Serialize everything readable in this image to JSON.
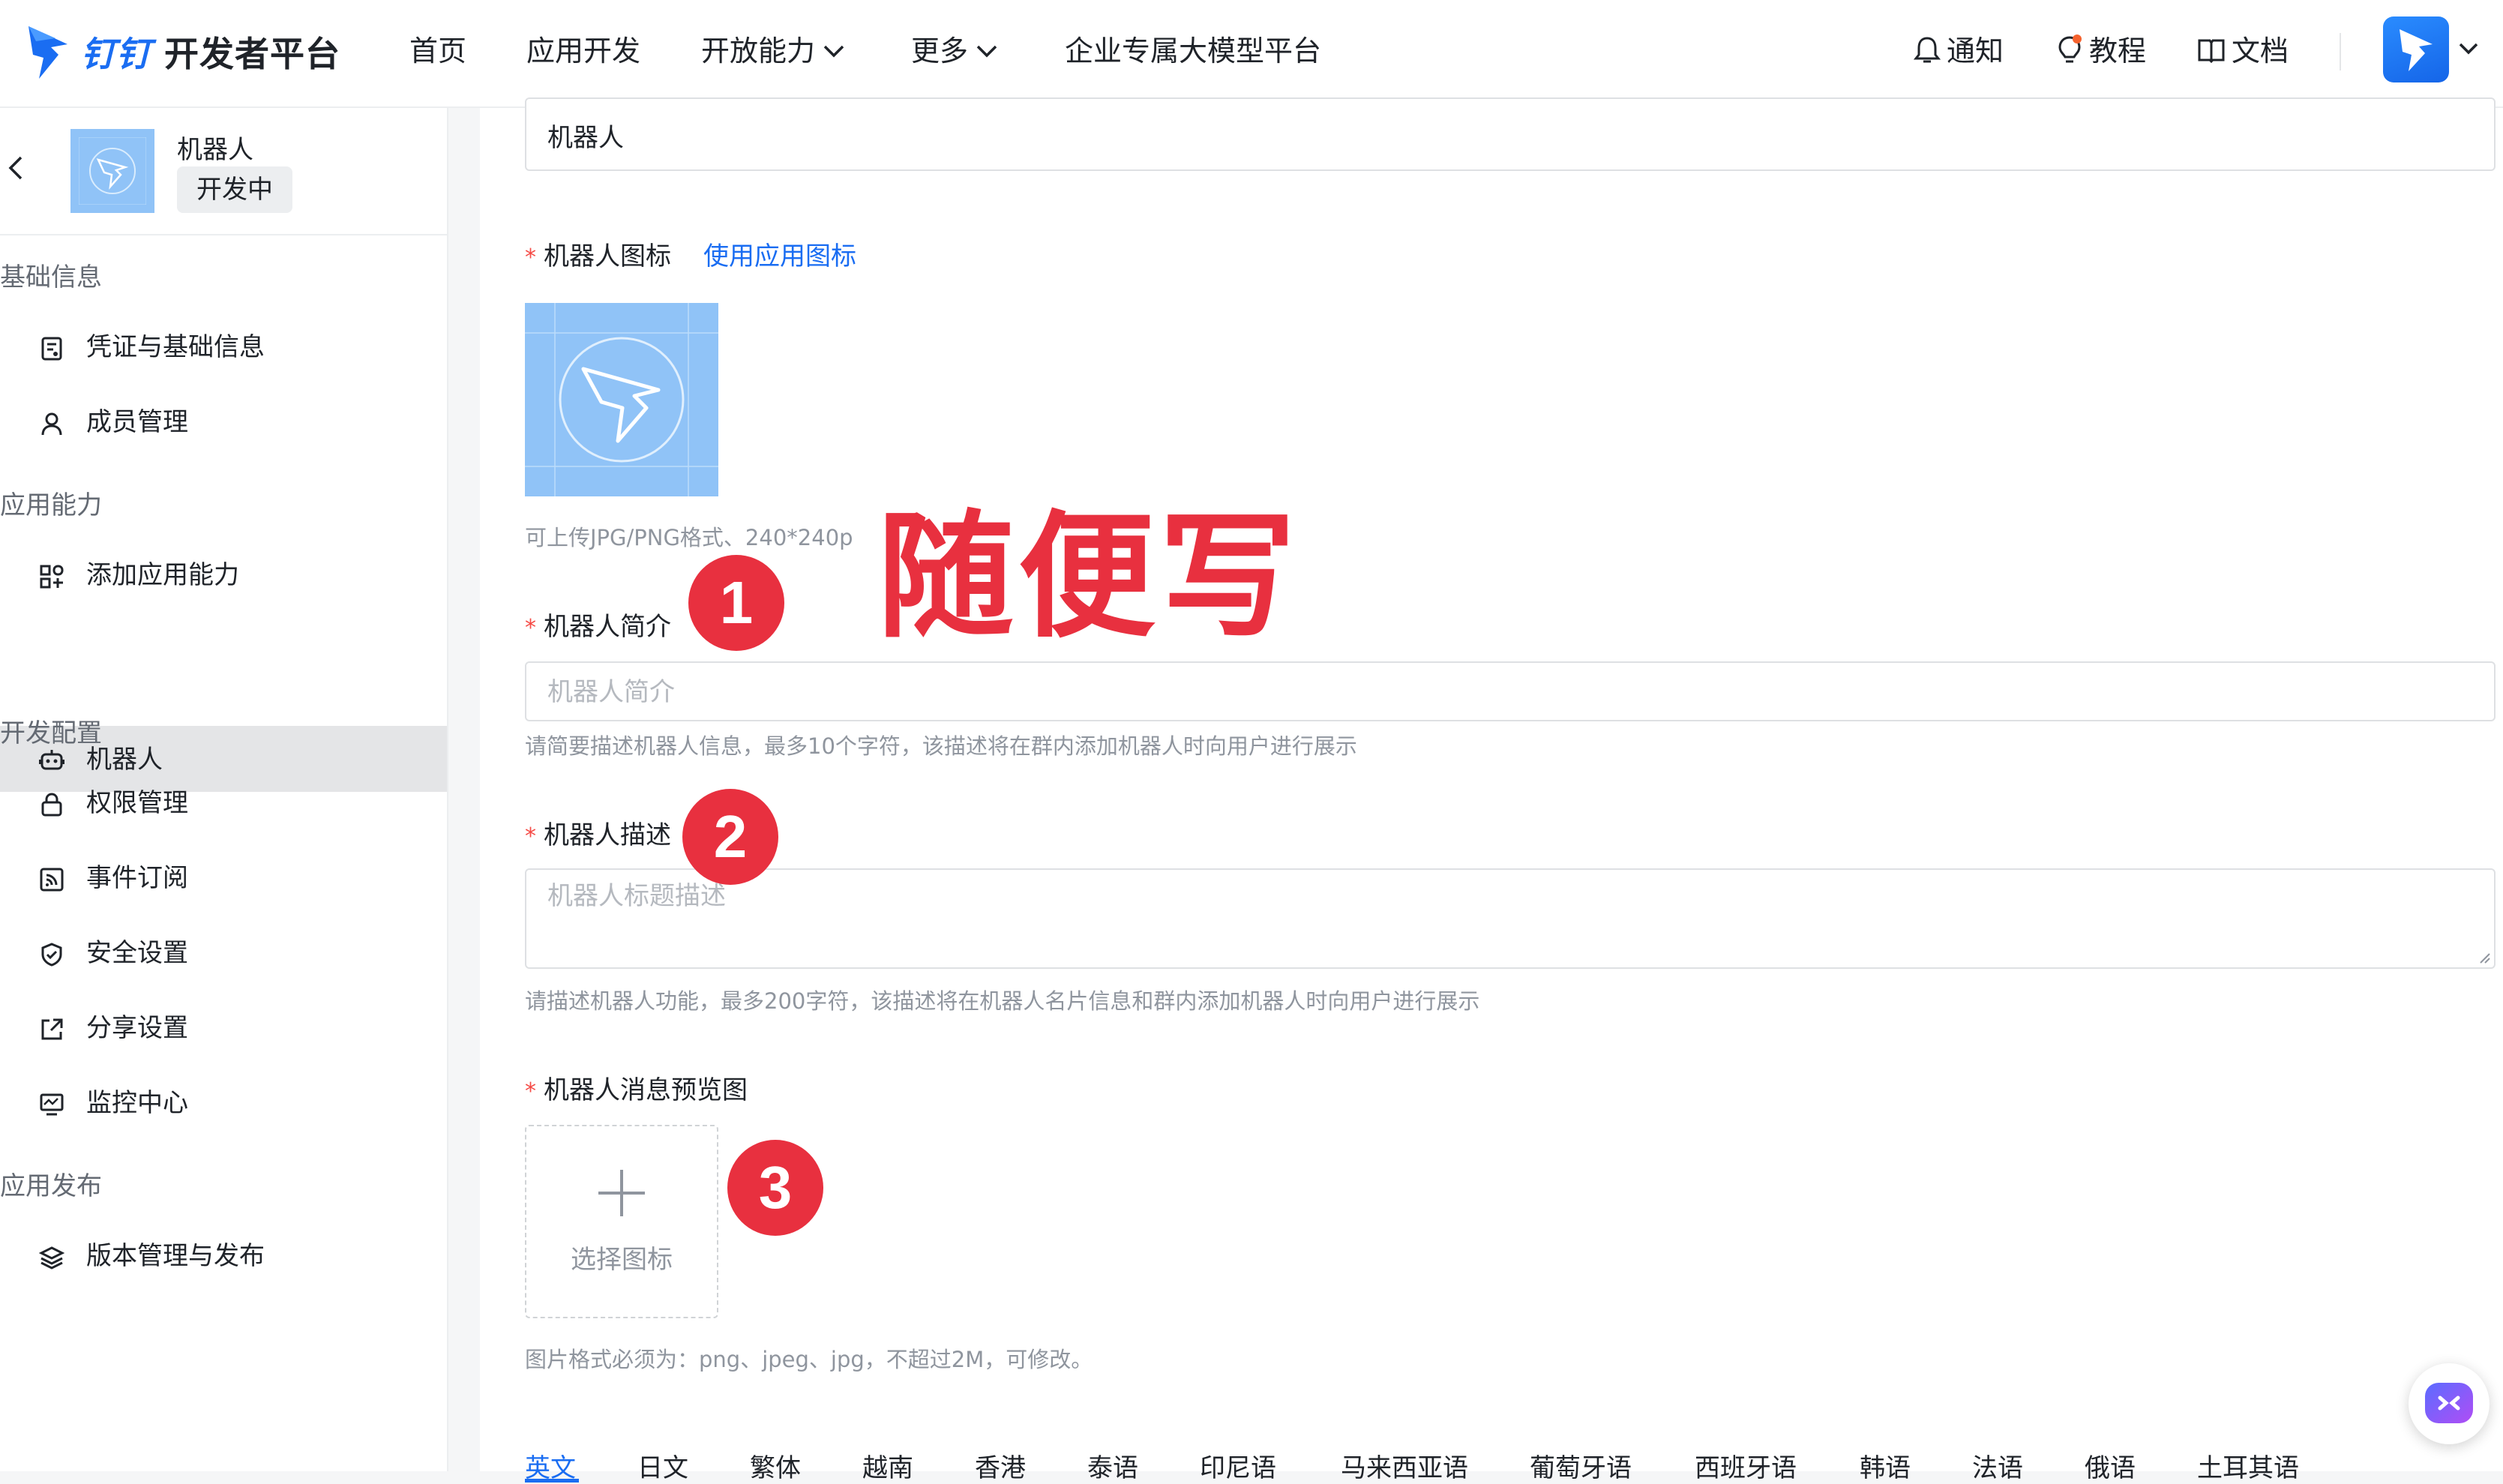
{
  "brand": {
    "ding": "钉钉",
    "name": "开发者平台"
  },
  "nav": [
    {
      "label": "首页"
    },
    {
      "label": "应用开发"
    },
    {
      "label": "开放能力"
    },
    {
      "label": "更多"
    },
    {
      "label": "企业专属大模型平台"
    }
  ],
  "header_right": {
    "notify": "通知",
    "tutorial": "教程",
    "docs": "文档"
  },
  "colors": {
    "accent": "#1a6df2",
    "annotation": "#e8303f",
    "icon_bg": "#90c3f7"
  },
  "sidebar": {
    "app_name": "机器人",
    "app_status": "开发中",
    "sections": {
      "basic": "基础信息",
      "ability": "应用能力",
      "dev": "开发配置",
      "publish": "应用发布"
    },
    "items": {
      "credentials": "凭证与基础信息",
      "members": "成员管理",
      "add_ability": "添加应用能力",
      "robot": "机器人",
      "permissions": "权限管理",
      "events": "事件订阅",
      "security": "安全设置",
      "share": "分享设置",
      "monitor": "监控中心",
      "version": "版本管理与发布"
    },
    "icons": {
      "credentials": "credential-icon",
      "members": "user-icon",
      "add_ability": "apps-add-icon",
      "robot": "robot-icon",
      "permissions": "lock-icon",
      "events": "rss-icon",
      "security": "shield-icon",
      "share": "share-icon",
      "monitor": "monitor-icon",
      "version": "layers-icon"
    }
  },
  "form": {
    "name_value": "机器人",
    "icon_label": "机器人图标",
    "icon_link": "使用应用图标",
    "icon_hint": "可上传JPG/PNG格式、240*240p",
    "intro_label": "机器人简介",
    "intro_placeholder": "机器人简介",
    "intro_hint": "请简要描述机器人信息，最多10个字符，该描述将在群内添加机器人时向用户进行展示",
    "desc_label": "机器人描述",
    "desc_placeholder": "机器人标题描述",
    "desc_hint": "请描述机器人功能，最多200字符，该描述将在机器人名片信息和群内添加机器人时向用户进行展示",
    "preview_label": "机器人消息预览图",
    "preview_button": "选择图标",
    "preview_hint": "图片格式必须为：png、jpeg、jpg，不超过2M，可修改。",
    "required_mark": "*"
  },
  "lang_tabs": [
    "英文",
    "日文",
    "繁体",
    "越南",
    "香港",
    "泰语",
    "印尼语",
    "马来西亚语",
    "葡萄牙语",
    "西班牙语",
    "韩语",
    "法语",
    "俄语",
    "土耳其语"
  ],
  "annotations": {
    "badge1": "1",
    "badge2": "2",
    "badge3": "3",
    "note": "随便写"
  }
}
